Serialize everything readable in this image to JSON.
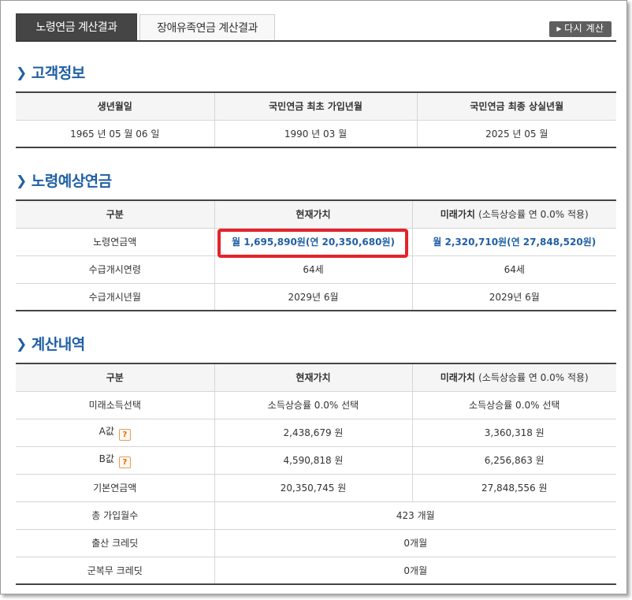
{
  "tabs": {
    "active": "노령연금 계산결과",
    "inactive": "장애유족연금 계산결과"
  },
  "redo_button": "다시 계산",
  "customer_info": {
    "title": "고객정보",
    "headers": [
      "생년월일",
      "국민연금 최초 가입년월",
      "국민연금 최종 상실년월"
    ],
    "values": [
      "1965 년 05 월 06 일",
      "1990 년 03 월",
      "2025 년 05 월"
    ]
  },
  "expected_pension": {
    "title": "노령예상연금",
    "headers": {
      "category": "구분",
      "present": "현재가치",
      "future": "미래가치",
      "future_note": "(소득상승률 연 0.0% 적용)"
    },
    "rows": [
      {
        "label": "노령연금액",
        "present": "월 1,695,890원(연 20,350,680원)",
        "future": "월 2,320,710원(연 27,848,520원)"
      },
      {
        "label": "수급개시연령",
        "present": "64세",
        "future": "64세"
      },
      {
        "label": "수급개시년월",
        "present": "2029년 6월",
        "future": "2029년 6월"
      }
    ]
  },
  "calculation": {
    "title": "계산내역",
    "headers": {
      "category": "구분",
      "present": "현재가치",
      "future": "미래가치",
      "future_note": "(소득상승률 연 0.0% 적용)"
    },
    "rows": [
      {
        "label": "미래소득선택",
        "present": "소득상승률 0.0% 선택",
        "future": "소득상승률 0.0% 선택"
      },
      {
        "label": "A값",
        "help": "?",
        "present": "2,438,679 원",
        "future": "3,360,318 원"
      },
      {
        "label": "B값",
        "help": "?",
        "present": "4,590,818 원",
        "future": "6,256,863 원"
      },
      {
        "label": "기본연금액",
        "present": "20,350,745 원",
        "future": "27,848,556 원"
      }
    ],
    "merged_rows": [
      {
        "label": "총 가입월수",
        "value": "423 개월"
      },
      {
        "label": "출산 크레딧",
        "value": "0개월"
      },
      {
        "label": "군복무 크레딧",
        "value": "0개월"
      }
    ]
  }
}
